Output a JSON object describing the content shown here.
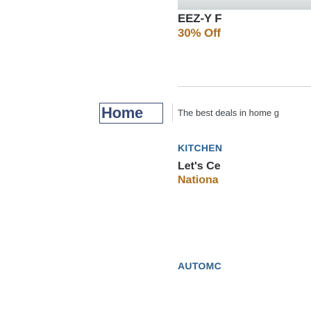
{
  "promo": {
    "title": "EEZ-Y F",
    "subtitle": "30% Off"
  },
  "header": {
    "logo_text": "Home",
    "tagline": "The best deals in home g"
  },
  "sections": [
    {
      "label": "KITCHEN",
      "title": "Let's Ce",
      "subtitle": "Nationa"
    },
    {
      "label": "AUTOMC"
    }
  ],
  "colors": {
    "heading": "#2d2f33",
    "accent_orange": "#ad6e1e",
    "section_blue": "#2b5f8e",
    "logo_navy": "#374875"
  }
}
